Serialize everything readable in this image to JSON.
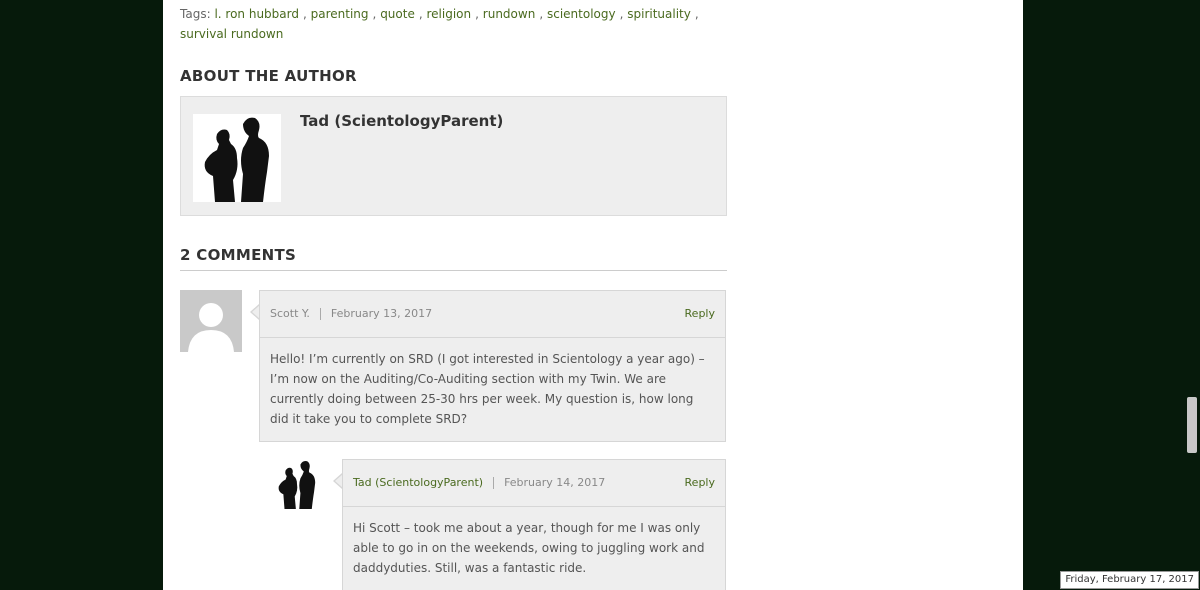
{
  "tags": {
    "label": "Tags:",
    "items": [
      "l. ron hubbard",
      "parenting",
      "quote",
      "religion",
      "rundown",
      "scientology",
      "spirituality",
      "survival rundown"
    ]
  },
  "about": {
    "heading": "ABOUT THE AUTHOR",
    "author_name": "Tad (ScientologyParent)"
  },
  "comments": {
    "heading": "2 COMMENTS",
    "items": [
      {
        "author": "Scott Y.",
        "date": "February 13, 2017",
        "reply_label": "Reply",
        "body": "Hello! I’m currently on SRD (I got interested in Scientology a year ago) – I’m now on the Auditing/Co-Auditing section with my Twin. We are currently doing between 25-30 hrs per week. My question is, how long did it take you to complete SRD?"
      },
      {
        "author": "Tad (ScientologyParent)",
        "date": "February 14, 2017",
        "reply_label": "Reply",
        "body": "Hi Scott – took me about a year, though for me I was only able to go in on the weekends, owing to juggling work and daddyduties. Still, was a fantastic ride."
      }
    ]
  },
  "taskbar": {
    "date": "Friday, February 17, 2017"
  },
  "colors": {
    "background": "#061a0b",
    "link": "#4a6a1f",
    "box": "#eeeeee"
  }
}
